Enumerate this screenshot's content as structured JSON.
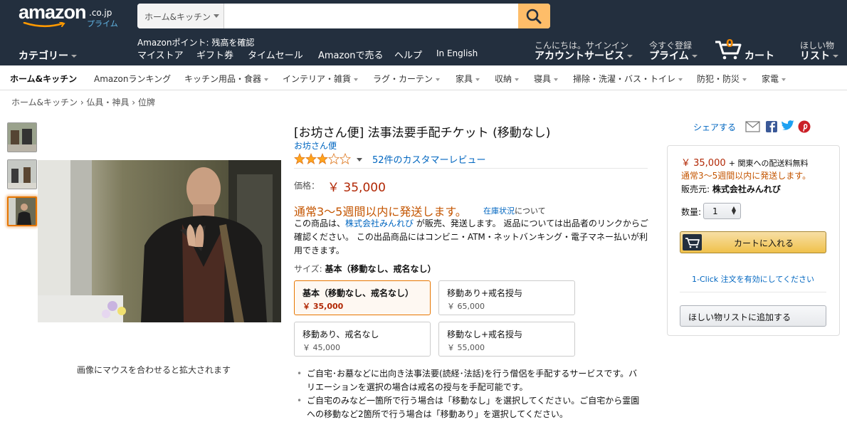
{
  "header": {
    "logo_text": "amazon",
    "logo_suffix": ".co.jp",
    "logo_prime": "プライム",
    "search_category": "ホーム&キッチン",
    "search_value": "",
    "points_text": "Amazonポイント: 残高を確認",
    "nav_links": [
      "マイストア",
      "ギフト券",
      "タイムセール",
      "Amazonで売る",
      "ヘルプ",
      "In English"
    ],
    "category_label": "カテゴリー",
    "account_line1": "こんにちは。サインイン",
    "account_line2": "アカウントサービス",
    "prime_line1": "今すぐ登録",
    "prime_line2": "プライム",
    "cart_count": "0",
    "cart_label": "カート",
    "wishlist_line1": "ほしい物",
    "wishlist_line2": "リスト"
  },
  "subnav": {
    "items": [
      "ホーム&キッチン",
      "Amazonランキング",
      "キッチン用品・食器",
      "インテリア・雑貨",
      "ラグ・カーテン",
      "家具",
      "収納",
      "寝具",
      "掃除・洗濯・バス・トイレ",
      "防犯・防災",
      "家電"
    ]
  },
  "breadcrumb": {
    "text": "ホーム&キッチン › 仏具・神具 › 位牌"
  },
  "gallery": {
    "zoom_hint": "画像にマウスを合わせると拡大されます",
    "selected_thumb": 3
  },
  "product": {
    "title": "[お坊さん便] 法事法要手配チケット (移動なし)",
    "brand": "お坊さん便",
    "rating": 3,
    "rating_max": 5,
    "reviews": "52件のカスタマーレビュー",
    "price_label": "価格：",
    "price": "￥ 35,000",
    "shipping": "通常3～5週間以内に発送します。",
    "stock_link": "在庫状況",
    "stock_suffix": "について",
    "desc_prefix": "この商品は、",
    "desc_seller": "株式会社みんれび",
    "desc_rest": " が販売、発送します。 返品については出品者のリンクからご確認ください。 この出品商品にはコンビニ・ATM・ネットバンキング・電子マネー払いが利用できます。",
    "size_label": "サイズ:",
    "size_value": "基本（移動なし、戒名なし）",
    "variations": [
      {
        "name": "基本（移動なし、戒名なし）",
        "price": "￥ 35,000",
        "selected": true
      },
      {
        "name": "移動あり+戒名授与",
        "price": "￥ 65,000",
        "selected": false
      },
      {
        "name": "移動あり、戒名なし",
        "price": "￥ 45,000",
        "selected": false
      },
      {
        "name": "移動なし+戒名授与",
        "price": "￥ 55,000",
        "selected": false
      }
    ],
    "bullets": [
      "ご自宅･お墓などに出向き法事法要(読経･法話)を行う僧侶を手配するサービスです。バリエーションを選択の場合は戒名の授与を手配可能です。",
      "ご自宅のみなど一箇所で行う場合は「移動なし」を選択してください。ご自宅から霊園への移動など2箇所で行う場合は「移動あり」を選択してください。"
    ]
  },
  "share": {
    "label": "シェアする"
  },
  "buybox": {
    "price": "￥ 35,000",
    "shipping_free": "+ 関東への配送料無料",
    "shipping_time": "通常3～5週間以内に発送します。",
    "seller_label": "販売元:",
    "seller_name": "株式会社みんれび",
    "qty_label": "数量:",
    "qty_value": "1",
    "add_to_cart": "カートに入れる",
    "one_click": "1-Click 注文を有効にしてください",
    "wishlist": "ほしい物リストに追加する"
  },
  "colors": {
    "header_bg": "#232f3e",
    "accent_orange": "#febd69",
    "price_red": "#b12704",
    "ship_orange": "#c45500",
    "link_blue": "#0066c0"
  }
}
